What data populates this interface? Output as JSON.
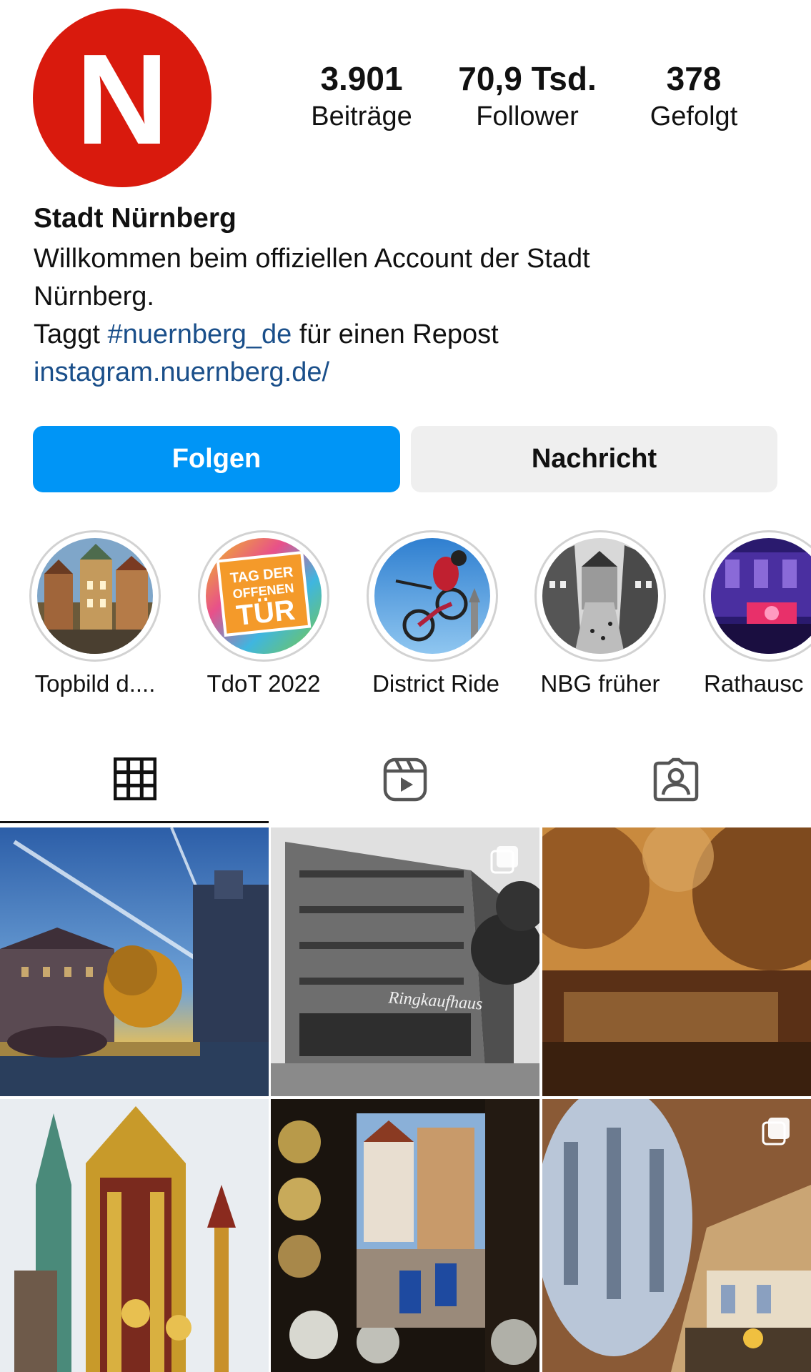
{
  "profile": {
    "avatar_letter": "N",
    "name": "Stadt Nürnberg",
    "bio_line1": "Willkommen beim offiziellen Account der Stadt",
    "bio_line2": "Nürnberg.",
    "bio_line3_prefix": "Taggt ",
    "bio_hashtag": "#nuernberg_de",
    "bio_line3_suffix": " für einen Repost",
    "website": "instagram.nuernberg.de/"
  },
  "stats": [
    {
      "value": "3.901",
      "label": "Beiträge"
    },
    {
      "value": "70,9 Tsd.",
      "label": "Follower"
    },
    {
      "value": "378",
      "label": "Gefolgt"
    }
  ],
  "actions": {
    "follow_label": "Folgen",
    "message_label": "Nachricht"
  },
  "highlights": [
    {
      "label": "Topbild d...."
    },
    {
      "label": "TdoT 2022",
      "badge_lines": [
        "TAG DER",
        "OFFENEN",
        "TÜR"
      ]
    },
    {
      "label": "District Ride"
    },
    {
      "label": "NBG früher"
    },
    {
      "label": "Rathausc"
    }
  ],
  "posts": [
    {
      "subject": "Weinstadel river sunset",
      "multi": false
    },
    {
      "subject": "Ringkaufhaus black and white",
      "sign_text": "Ringkaufhaus",
      "multi": true
    },
    {
      "subject": "autumn river fog",
      "multi": false
    },
    {
      "subject": "Schöner Brunnen fountain",
      "multi": false
    },
    {
      "subject": "old town through glass window",
      "multi": false
    },
    {
      "subject": "Rathaus hall interior",
      "multi": true
    }
  ],
  "tabs": [
    "grid-icon",
    "reels-icon",
    "tagged-icon"
  ],
  "colors": {
    "brand_red": "#d91a0d",
    "follow_blue": "#0095f6",
    "link_blue": "#1a4f8a",
    "message_bg": "#efefef"
  }
}
